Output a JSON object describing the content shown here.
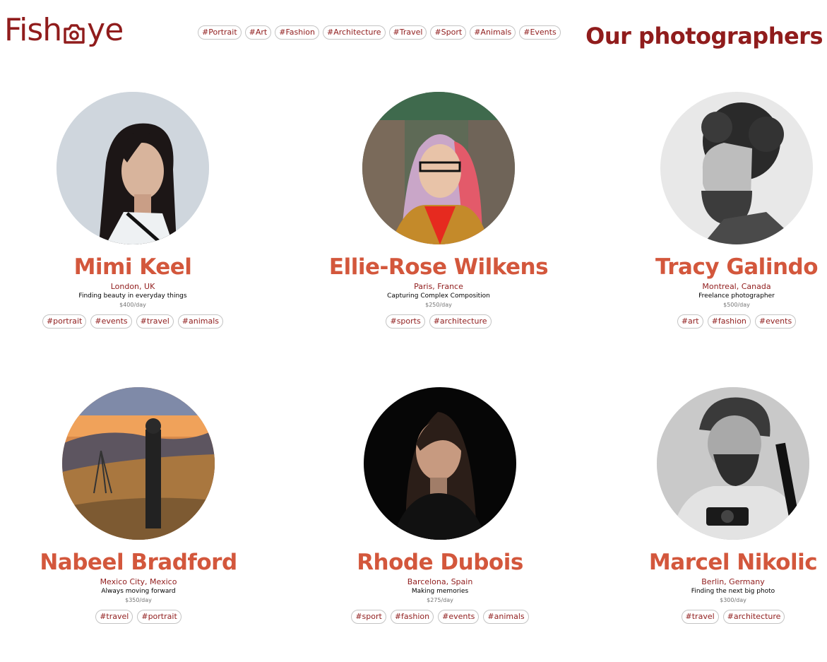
{
  "brand": {
    "logo_prefix": "Fish",
    "logo_suffix": "ye",
    "logo_icon": "camera-icon",
    "color": "#901c1c"
  },
  "nav": {
    "tags": [
      "#Portrait",
      "#Art",
      "#Fashion",
      "#Architecture",
      "#Travel",
      "#Sport",
      "#Animals",
      "#Events"
    ]
  },
  "page": {
    "heading": "Our photographers"
  },
  "colors": {
    "name": "#d3573c",
    "location": "#901c1c",
    "price": "#757575",
    "tag_border": "#c4c4c4"
  },
  "photographers": [
    {
      "name": "Mimi Keel",
      "location": "London, UK",
      "tagline": "Finding beauty in everyday things",
      "price": "$400/day",
      "tags": [
        "#portrait",
        "#events",
        "#travel",
        "#animals"
      ]
    },
    {
      "name": "Ellie-Rose Wilkens",
      "location": "Paris, France",
      "tagline": "Capturing Complex Composition",
      "price": "$250/day",
      "tags": [
        "#sports",
        "#architecture"
      ]
    },
    {
      "name": "Tracy Galindo",
      "location": "Montreal, Canada",
      "tagline": "Freelance photographer",
      "price": "$500/day",
      "tags": [
        "#art",
        "#fashion",
        "#events"
      ]
    },
    {
      "name": "Nabeel Bradford",
      "location": "Mexico City, Mexico",
      "tagline": "Always moving forward",
      "price": "$350/day",
      "tags": [
        "#travel",
        "#portrait"
      ]
    },
    {
      "name": "Rhode Dubois",
      "location": "Barcelona, Spain",
      "tagline": "Making memories",
      "price": "$275/day",
      "tags": [
        "#sport",
        "#fashion",
        "#events",
        "#animals"
      ]
    },
    {
      "name": "Marcel Nikolic",
      "location": "Berlin, Germany",
      "tagline": "Finding the next big photo",
      "price": "$300/day",
      "tags": [
        "#travel",
        "#architecture"
      ]
    }
  ]
}
